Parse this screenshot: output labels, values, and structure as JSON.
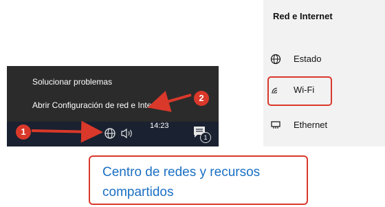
{
  "context_menu": {
    "items": [
      {
        "label": "Solucionar problemas"
      },
      {
        "label": "Abrir Configuración de red e Internet"
      }
    ]
  },
  "taskbar": {
    "time": "14:23",
    "notification_count": "1",
    "icons": [
      "globe-icon",
      "speaker-icon",
      "notification-icon"
    ]
  },
  "steps": {
    "one": "1",
    "two": "2"
  },
  "settings": {
    "title": "Red e Internet",
    "nav": [
      {
        "label": "Estado",
        "icon": "globe-icon"
      },
      {
        "label": "Wi-Fi",
        "icon": "wifi-icon"
      },
      {
        "label": "Ethernet",
        "icon": "ethernet-icon"
      }
    ]
  },
  "link": {
    "label": "Centro de redes y recursos compartidos"
  },
  "colors": {
    "highlight": "#d9382a",
    "link": "#1a6fc4",
    "menu_bg": "#2b2b2b",
    "taskbar_bg": "#1a2130"
  }
}
